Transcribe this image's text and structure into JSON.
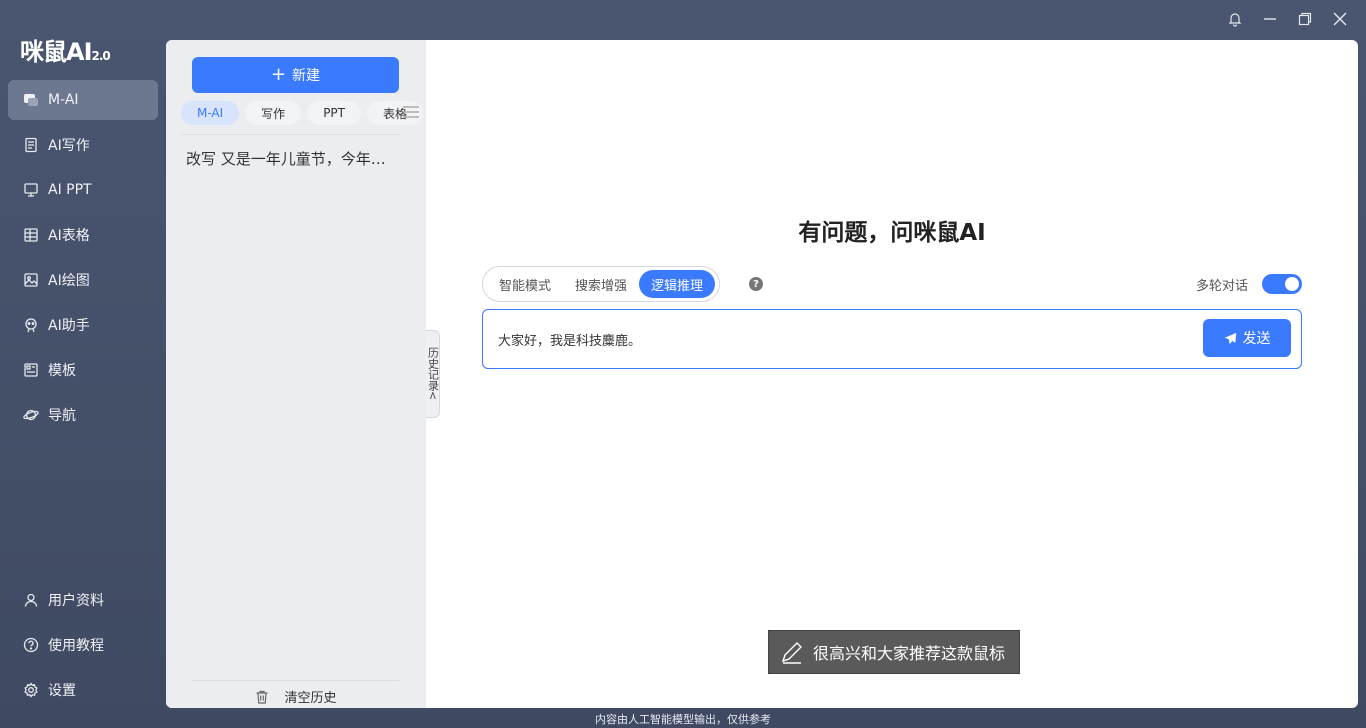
{
  "app": {
    "logo_text": "咪鼠AI",
    "logo_version": "2.0"
  },
  "nav": {
    "items": [
      {
        "label": "M-AI",
        "icon": "chat-icon",
        "active": true
      },
      {
        "label": "AI写作",
        "icon": "document-icon"
      },
      {
        "label": "AI PPT",
        "icon": "ppt-icon"
      },
      {
        "label": "AI表格",
        "icon": "table-icon"
      },
      {
        "label": "AI绘图",
        "icon": "image-icon"
      },
      {
        "label": "AI助手",
        "icon": "assistant-icon"
      },
      {
        "label": "模板",
        "icon": "template-icon"
      },
      {
        "label": "导航",
        "icon": "planet-icon"
      }
    ],
    "bottom": [
      {
        "label": "用户资料",
        "icon": "user-icon"
      },
      {
        "label": "使用教程",
        "icon": "help-icon"
      },
      {
        "label": "设置",
        "icon": "gear-icon"
      }
    ]
  },
  "history": {
    "new_button": "新建",
    "tabs": [
      "M-AI",
      "写作",
      "PPT",
      "表格"
    ],
    "items": [
      "改写 又是一年儿童节，今年…"
    ],
    "clear_label": "清空历史",
    "handle_label": "历史记录<"
  },
  "main": {
    "heading": "有问题，问咪鼠AI",
    "modes": [
      "智能模式",
      "搜索增强",
      "逻辑推理"
    ],
    "active_mode": "逻辑推理",
    "multi_turn_label": "多轮对话",
    "multi_turn_on": true,
    "input_value": "大家好，我是科技麋鹿。",
    "send_label": "发送"
  },
  "toast": {
    "text": "很高兴和大家推荐这款鼠标"
  },
  "footer_note": "内容由人工智能模型输出，仅供参考",
  "colors": {
    "accent": "#3a7afe",
    "sidebar_bg": "#465269",
    "panel_bg": "#ffffff"
  }
}
